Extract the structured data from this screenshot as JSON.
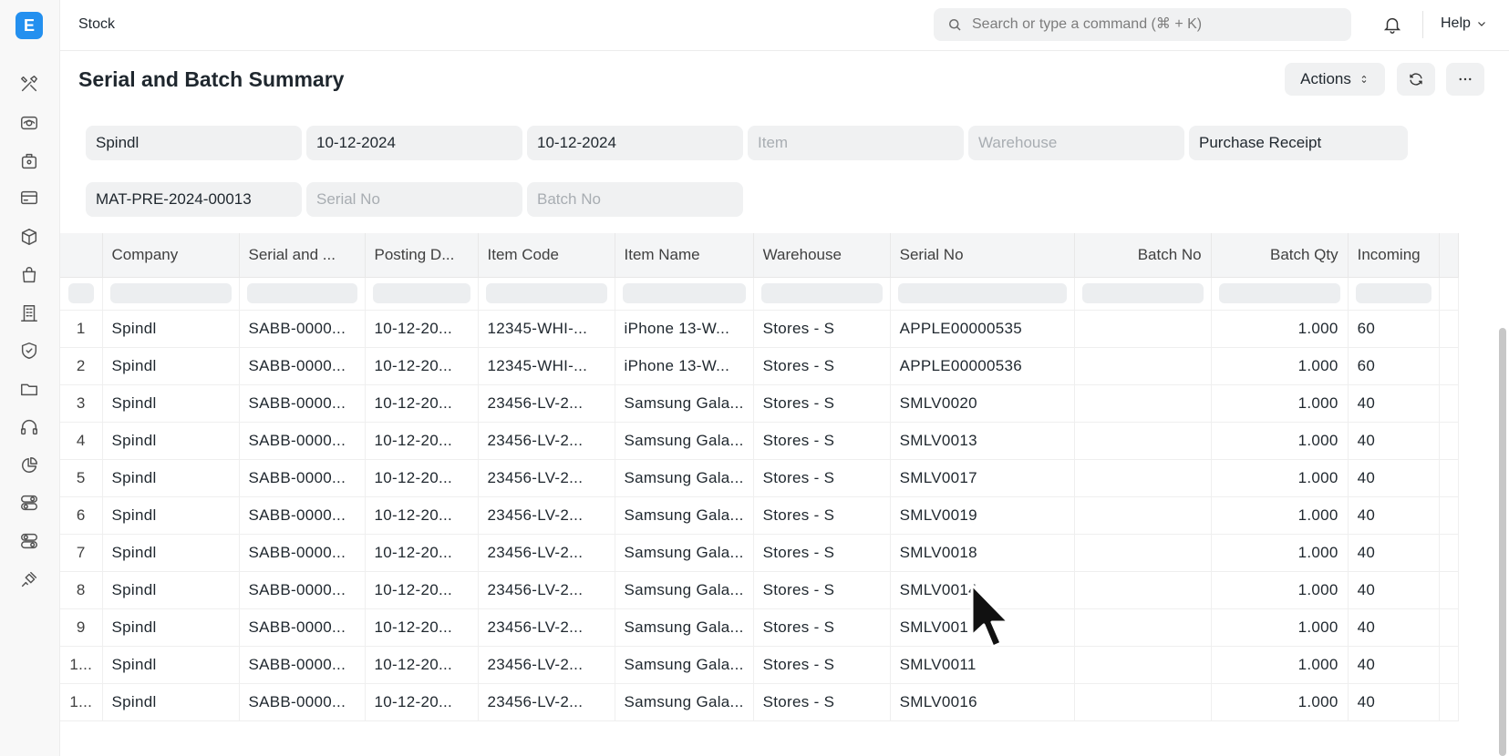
{
  "app": {
    "logo_letter": "E",
    "breadcrumb": "Stock",
    "search_placeholder": "Search or type a command (⌘ + K)",
    "help_label": "Help"
  },
  "sidebar_icons": [
    "tools-icon",
    "eye-icon",
    "cash-register-icon",
    "card-icon",
    "cube-icon",
    "bag-icon",
    "building-icon",
    "shield-icon",
    "folder-icon",
    "headset-icon",
    "pie-icon",
    "toggle-icon",
    "toggle-alt-icon",
    "plug-icon"
  ],
  "page": {
    "title": "Serial and Batch Summary",
    "actions_label": "Actions"
  },
  "filters": {
    "company": "Spindl",
    "from_date": "10-12-2024",
    "to_date": "10-12-2024",
    "item_placeholder": "Item",
    "warehouse_placeholder": "Warehouse",
    "voucher_type": "Purchase Receipt",
    "voucher_no": "MAT-PRE-2024-00013",
    "serial_placeholder": "Serial No",
    "batch_placeholder": "Batch No"
  },
  "table": {
    "columns": [
      "Company",
      "Serial and ...",
      "Posting D...",
      "Item Code",
      "Item Name",
      "Warehouse",
      "Serial No",
      "Batch No",
      "Batch Qty",
      "Incoming"
    ],
    "rows": [
      {
        "idx": "1",
        "company": "Spindl",
        "sabb": "SABB-0000...",
        "posting": "10-12-20...",
        "item_code": "12345-WHI-...",
        "item_name": "iPhone 13-W...",
        "warehouse": "Stores - S",
        "serial": "APPLE00000535",
        "batch": "",
        "qty": "1.000",
        "incoming": "60"
      },
      {
        "idx": "2",
        "company": "Spindl",
        "sabb": "SABB-0000...",
        "posting": "10-12-20...",
        "item_code": "12345-WHI-...",
        "item_name": "iPhone 13-W...",
        "warehouse": "Stores - S",
        "serial": "APPLE00000536",
        "batch": "",
        "qty": "1.000",
        "incoming": "60"
      },
      {
        "idx": "3",
        "company": "Spindl",
        "sabb": "SABB-0000...",
        "posting": "10-12-20...",
        "item_code": "23456-LV-2...",
        "item_name": "Samsung Gala...",
        "warehouse": "Stores - S",
        "serial": "SMLV0020",
        "batch": "",
        "qty": "1.000",
        "incoming": "40"
      },
      {
        "idx": "4",
        "company": "Spindl",
        "sabb": "SABB-0000...",
        "posting": "10-12-20...",
        "item_code": "23456-LV-2...",
        "item_name": "Samsung Gala...",
        "warehouse": "Stores - S",
        "serial": "SMLV0013",
        "batch": "",
        "qty": "1.000",
        "incoming": "40"
      },
      {
        "idx": "5",
        "company": "Spindl",
        "sabb": "SABB-0000...",
        "posting": "10-12-20...",
        "item_code": "23456-LV-2...",
        "item_name": "Samsung Gala...",
        "warehouse": "Stores - S",
        "serial": "SMLV0017",
        "batch": "",
        "qty": "1.000",
        "incoming": "40"
      },
      {
        "idx": "6",
        "company": "Spindl",
        "sabb": "SABB-0000...",
        "posting": "10-12-20...",
        "item_code": "23456-LV-2...",
        "item_name": "Samsung Gala...",
        "warehouse": "Stores - S",
        "serial": "SMLV0019",
        "batch": "",
        "qty": "1.000",
        "incoming": "40"
      },
      {
        "idx": "7",
        "company": "Spindl",
        "sabb": "SABB-0000...",
        "posting": "10-12-20...",
        "item_code": "23456-LV-2...",
        "item_name": "Samsung Gala...",
        "warehouse": "Stores - S",
        "serial": "SMLV0018",
        "batch": "",
        "qty": "1.000",
        "incoming": "40"
      },
      {
        "idx": "8",
        "company": "Spindl",
        "sabb": "SABB-0000...",
        "posting": "10-12-20...",
        "item_code": "23456-LV-2...",
        "item_name": "Samsung Gala...",
        "warehouse": "Stores - S",
        "serial": "SMLV0014",
        "batch": "",
        "qty": "1.000",
        "incoming": "40"
      },
      {
        "idx": "9",
        "company": "Spindl",
        "sabb": "SABB-0000...",
        "posting": "10-12-20...",
        "item_code": "23456-LV-2...",
        "item_name": "Samsung Gala...",
        "warehouse": "Stores - S",
        "serial": "SMLV001",
        "batch": "",
        "qty": "1.000",
        "incoming": "40"
      },
      {
        "idx": "1...",
        "company": "Spindl",
        "sabb": "SABB-0000...",
        "posting": "10-12-20...",
        "item_code": "23456-LV-2...",
        "item_name": "Samsung Gala...",
        "warehouse": "Stores - S",
        "serial": "SMLV0011",
        "batch": "",
        "qty": "1.000",
        "incoming": "40"
      },
      {
        "idx": "1...",
        "company": "Spindl",
        "sabb": "SABB-0000...",
        "posting": "10-12-20...",
        "item_code": "23456-LV-2...",
        "item_name": "Samsung Gala...",
        "warehouse": "Stores - S",
        "serial": "SMLV0016",
        "batch": "",
        "qty": "1.000",
        "incoming": "40"
      }
    ]
  },
  "colors": {
    "accent": "#2490ef",
    "control_bg": "#f0f1f2",
    "header_bg": "#f4f5f6"
  }
}
